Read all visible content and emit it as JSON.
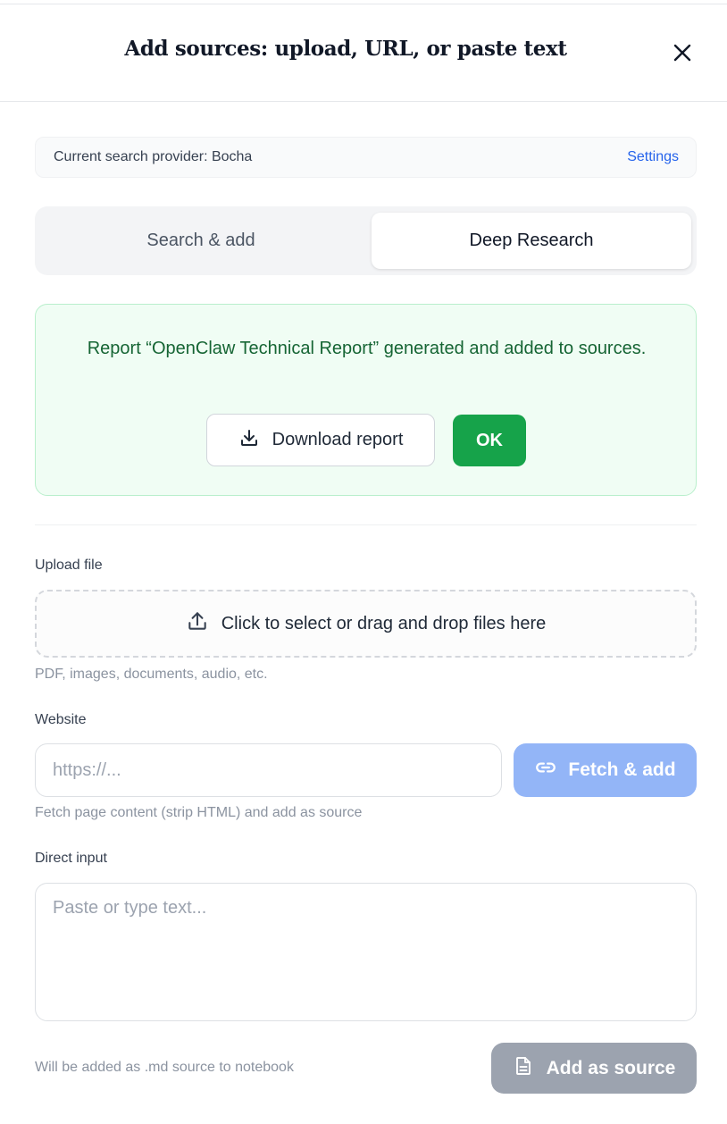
{
  "dialog": {
    "title": "Add sources: upload, URL, or paste text"
  },
  "provider": {
    "text": "Current search provider: Bocha",
    "settings_label": "Settings"
  },
  "tabs": [
    {
      "label": "Search & add",
      "active": false
    },
    {
      "label": "Deep Research",
      "active": true
    }
  ],
  "result": {
    "message": "Report “OpenClaw Technical Report” generated and added to sources.",
    "download_label": "Download report",
    "ok_label": "OK"
  },
  "upload": {
    "label": "Upload file",
    "dropzone_text": "Click to select or drag and drop files here",
    "hint": "PDF, images, documents, audio, etc."
  },
  "website": {
    "label": "Website",
    "value": "",
    "placeholder": "https://...",
    "fetch_label": "Fetch & add",
    "hint": "Fetch page content (strip HTML) and add as source"
  },
  "direct_input": {
    "label": "Direct input",
    "value": "",
    "placeholder": "Paste or type text...",
    "hint": "Will be added as .md source to notebook",
    "add_label": "Add as source"
  },
  "colors": {
    "success_bg": "#f0fdf4",
    "success_text": "#166534",
    "ok_button": "#16a34a",
    "link": "#2563eb",
    "fetch_button": "#93b5f7",
    "add_button": "#9ca3af"
  },
  "icons": {
    "close": "close-icon",
    "download": "download-icon",
    "upload": "upload-icon",
    "link": "link-icon",
    "document": "document-icon"
  }
}
